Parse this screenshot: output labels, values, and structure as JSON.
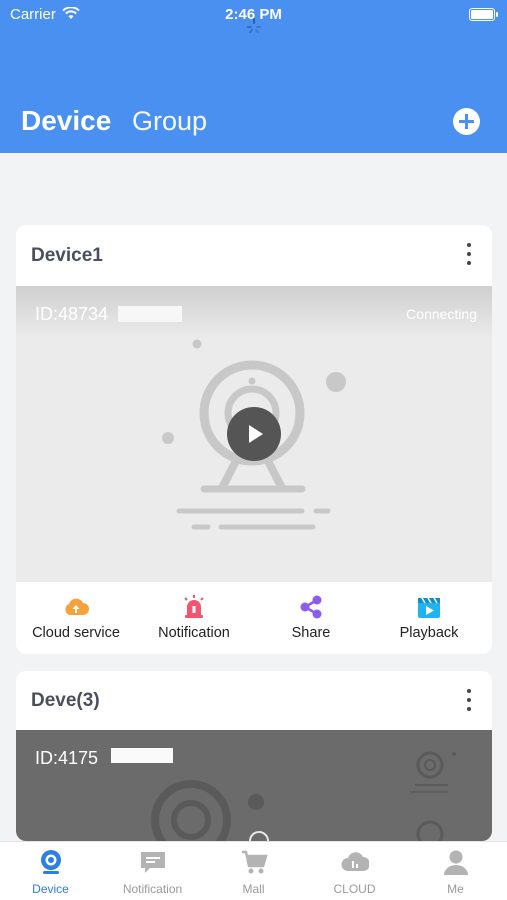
{
  "status_bar": {
    "carrier": "Carrier",
    "time": "2:46 PM"
  },
  "header": {
    "tab_device": "Device",
    "tab_group": "Group",
    "add_icon": "plus-circle-icon"
  },
  "devices": [
    {
      "name": "Device1",
      "id_text": "ID:48734",
      "status": "Connecting",
      "actions": [
        {
          "label": "Cloud service",
          "icon": "cloud-upload-icon",
          "color": "#f5a23c"
        },
        {
          "label": "Notification",
          "icon": "siren-icon",
          "color": "#f0566e"
        },
        {
          "label": "Share",
          "icon": "share-icon",
          "color": "#8c5cf0"
        },
        {
          "label": "Playback",
          "icon": "playback-icon",
          "color": "#1eb4f0"
        }
      ]
    },
    {
      "name": "Deve(3)",
      "id_text": "ID:4175"
    }
  ],
  "tabbar": [
    {
      "label": "Device",
      "icon": "device-camera-icon",
      "active": true
    },
    {
      "label": "Notification",
      "icon": "message-icon"
    },
    {
      "label": "Mall",
      "icon": "cart-icon"
    },
    {
      "label": "CLOUD",
      "icon": "cloud-icon"
    },
    {
      "label": "Me",
      "icon": "user-icon"
    }
  ],
  "colors": {
    "header": "#4a90f0",
    "active_tab": "#2f7de8"
  }
}
